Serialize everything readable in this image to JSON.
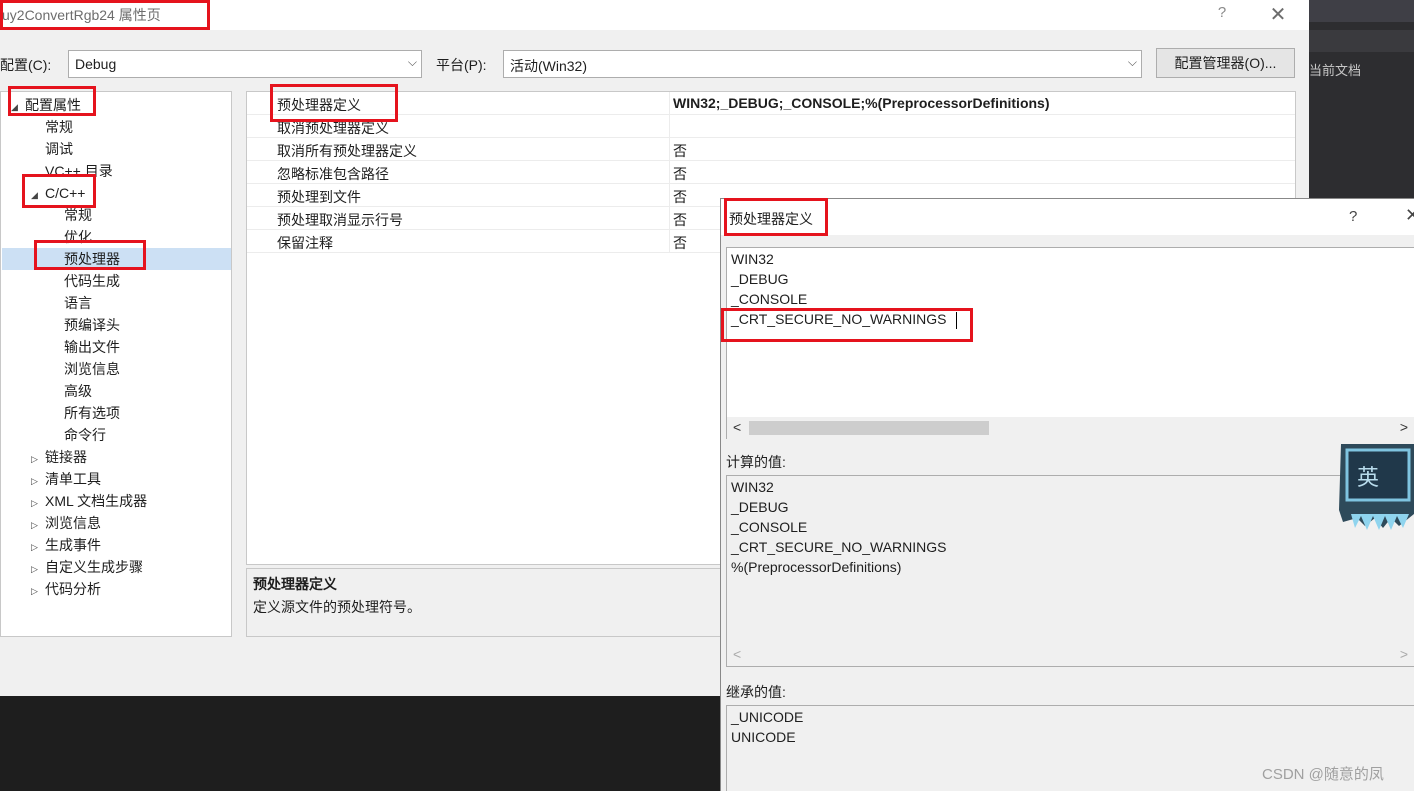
{
  "main_dialog": {
    "title": "uy2ConvertRgb24 属性页",
    "help": "?",
    "close": "✕",
    "config_label": "配置(C):",
    "config_value": "Debug",
    "platform_label": "平台(P):",
    "platform_value": "活动(Win32)",
    "config_manager_button": "配置管理器(O)..."
  },
  "tree": {
    "root": "配置属性",
    "items": [
      "常规",
      "调试",
      "VC++ 目录",
      "C/C++",
      "常规",
      "优化",
      "预处理器",
      "代码生成",
      "语言",
      "预编译头",
      "输出文件",
      "浏览信息",
      "高级",
      "所有选项",
      "命令行",
      "链接器",
      "清单工具",
      "XML 文档生成器",
      "浏览信息",
      "生成事件",
      "自定义生成步骤",
      "代码分析"
    ]
  },
  "grid": {
    "rows": [
      {
        "name": "预处理器定义",
        "value": "WIN32;_DEBUG;_CONSOLE;%(PreprocessorDefinitions)"
      },
      {
        "name": "取消预处理器定义",
        "value": ""
      },
      {
        "name": "取消所有预处理器定义",
        "value": "否"
      },
      {
        "name": "忽略标准包含路径",
        "value": "否"
      },
      {
        "name": "预处理到文件",
        "value": "否"
      },
      {
        "name": "预处理取消显示行号",
        "value": "否"
      },
      {
        "name": "保留注释",
        "value": "否"
      }
    ]
  },
  "description": {
    "title": "预处理器定义",
    "text": "定义源文件的预处理符号。"
  },
  "popup": {
    "title": "预处理器定义",
    "help": "?",
    "close": "✕",
    "edit_lines": [
      "WIN32",
      "_DEBUG",
      "_CONSOLE",
      "_CRT_SECURE_NO_WARNINGS"
    ],
    "computed_label": "计算的值:",
    "computed_lines": [
      "WIN32",
      "_DEBUG",
      "_CONSOLE",
      "_CRT_SECURE_NO_WARNINGS",
      "%(PreprocessorDefinitions)"
    ],
    "inherited_label": "继承的值:",
    "inherited_lines": [
      "_UNICODE",
      "UNICODE"
    ]
  },
  "background": {
    "tab_text": "当前文档"
  },
  "ime_indicator": "英",
  "watermark": "CSDN @随意的凤",
  "colors": {
    "annotation": "#e5131d",
    "selection": "#cce0f4"
  }
}
